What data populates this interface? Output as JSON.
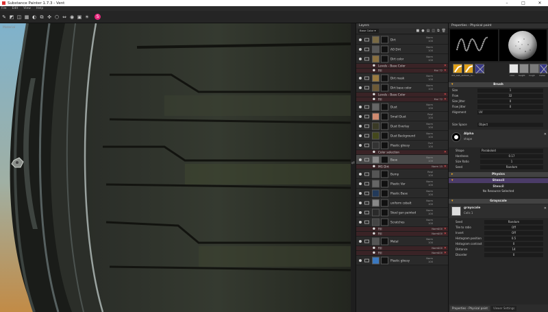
{
  "window": {
    "title": "Substance Painter 1.7.3 - Vent"
  },
  "menu": [
    "File",
    "Edit",
    "View",
    "Help"
  ],
  "viewport": {
    "label": "Material"
  },
  "layers": {
    "panel_title": "Layers",
    "channel": "Base Color",
    "rows": [
      {
        "kind": "layer",
        "name": "Dirt",
        "blend": "Norm",
        "opacity": "100",
        "thumb": "#7a6a44"
      },
      {
        "kind": "layer",
        "name": "AO Dirt",
        "blend": "Norm",
        "opacity": "100",
        "thumb": "#585858"
      },
      {
        "kind": "layer",
        "name": "Dirt color",
        "blend": "Norm",
        "opacity": "100",
        "thumb": "#8a7040"
      },
      {
        "kind": "effect",
        "name": "Levels - Base Color",
        "blend": "",
        "opacity": ""
      },
      {
        "kind": "effect",
        "name": "Fill",
        "blend": "Mul",
        "opacity": "72"
      },
      {
        "kind": "layer",
        "name": "Dirt mask",
        "blend": "Norm",
        "opacity": "100",
        "thumb": "#9a7a40"
      },
      {
        "kind": "layer",
        "name": "Dirt base color",
        "blend": "Norm",
        "opacity": "100",
        "thumb": "#6d5a36"
      },
      {
        "kind": "effect",
        "name": "Levels - Base Color",
        "blend": "",
        "opacity": ""
      },
      {
        "kind": "effect",
        "name": "Fill",
        "blend": "Mul",
        "opacity": "72"
      },
      {
        "kind": "layer",
        "name": "Dust",
        "blend": "Norm",
        "opacity": "100",
        "thumb": "#666"
      },
      {
        "kind": "layer",
        "name": "Small Dust",
        "blend": "Repl",
        "opacity": "100",
        "thumb": "#d08a70"
      },
      {
        "kind": "layer",
        "name": "Dust Overlay",
        "blend": "Norm",
        "opacity": "100",
        "thumb": "#3a3a26"
      },
      {
        "kind": "layer",
        "name": "Dust Background",
        "blend": "Norm",
        "opacity": "100",
        "thumb": "#44481c"
      },
      {
        "kind": "layer",
        "name": "Plastic glossy",
        "blend": "Ovrl",
        "opacity": "100",
        "thumb": "#333"
      },
      {
        "kind": "effect",
        "name": "Color selection",
        "blend": "",
        "opacity": ""
      },
      {
        "kind": "selected",
        "name": "Base",
        "blend": "Norm",
        "opacity": "100",
        "thumb": "#888"
      },
      {
        "kind": "effect",
        "name": "MG Dirt",
        "blend": "Norm",
        "opacity": "15"
      },
      {
        "kind": "layer",
        "name": "Bump",
        "blend": "Repl",
        "opacity": "100",
        "thumb": "#555"
      },
      {
        "kind": "layer",
        "name": "Plastic Var",
        "blend": "Norm",
        "opacity": "100",
        "thumb": "#666"
      },
      {
        "kind": "layer",
        "name": "Plastic Base",
        "blend": "Norm",
        "opacity": "100",
        "thumb": "#223a5a"
      },
      {
        "kind": "layer",
        "name": "uniform cobalt",
        "blend": "Norm",
        "opacity": "100",
        "thumb": "#888"
      },
      {
        "kind": "layer",
        "name": "Steel gun painted",
        "blend": "Norm",
        "opacity": "100",
        "thumb": "#2a2a2a"
      },
      {
        "kind": "layer",
        "name": "Scratches",
        "blend": "Norm",
        "opacity": "100",
        "thumb": "#444"
      },
      {
        "kind": "effect",
        "name": "Fill",
        "blend": "Norm",
        "opacity": "100"
      },
      {
        "kind": "effect",
        "name": "Fill",
        "blend": "Norm",
        "opacity": "100"
      },
      {
        "kind": "layer",
        "name": "Metal",
        "blend": "Norm",
        "opacity": "100",
        "thumb": "#555"
      },
      {
        "kind": "effect",
        "name": "Fill",
        "blend": "Norm",
        "opacity": "100"
      },
      {
        "kind": "effect",
        "name": "Fill",
        "blend": "Norm",
        "opacity": "100"
      },
      {
        "kind": "layer",
        "name": "Plastic glossy",
        "blend": "Norm",
        "opacity": "100",
        "thumb": "#3a78c0"
      }
    ]
  },
  "properties": {
    "panel_title": "Properties - Physical paint",
    "tool_labels": [
      "dirt_leak_2",
      "artistic_m...",
      "",
      "color",
      "height",
      "rough",
      "metal"
    ],
    "brush": {
      "title": "Brush",
      "size_label": "Size",
      "size": "1",
      "flow_label": "Flow",
      "flow": "32",
      "size_jitter_label": "Size Jitter",
      "size_jitter": "0",
      "flow_jitter_label": "Flow Jitter",
      "flow_jitter": "0",
      "alignment_label": "Alignment",
      "alignment": "UV",
      "size_space_label": "Size Space",
      "size_space": "Object"
    },
    "alpha": {
      "title": "Alpha",
      "subtitle": "shape",
      "shape_label": "Shape",
      "shape": "Paraboloid",
      "hardness_label": "Hardness",
      "hardness": "0.17",
      "size_ratio_label": "Size Ratio",
      "size_ratio": "1",
      "seed_label": "Seed",
      "seed": "Random"
    },
    "physics": {
      "title": "Physics"
    },
    "stencil": {
      "title": "Stencil",
      "sub": "Stencil",
      "value": "No Resource Selected"
    },
    "grayscale": {
      "title": "Grayscale",
      "name": "grayscale",
      "subtitle": "Cells 1",
      "seed_label": "Seed",
      "seed": "Random",
      "tile_ratio_label": "Tile to ratio",
      "tile_ratio": "Off",
      "invert_label": "Invert",
      "invert": "Off",
      "hist_pos_label": "Histogram position",
      "hist_pos": "0.5",
      "hist_con_label": "Histogram contrast",
      "hist_con": "0",
      "distance_label": "Distance",
      "distance": "14",
      "disorder_label": "Disorder",
      "disorder": "0"
    }
  },
  "bottom_tabs": [
    "Properties - Physical paint",
    "Viewer Settings"
  ]
}
